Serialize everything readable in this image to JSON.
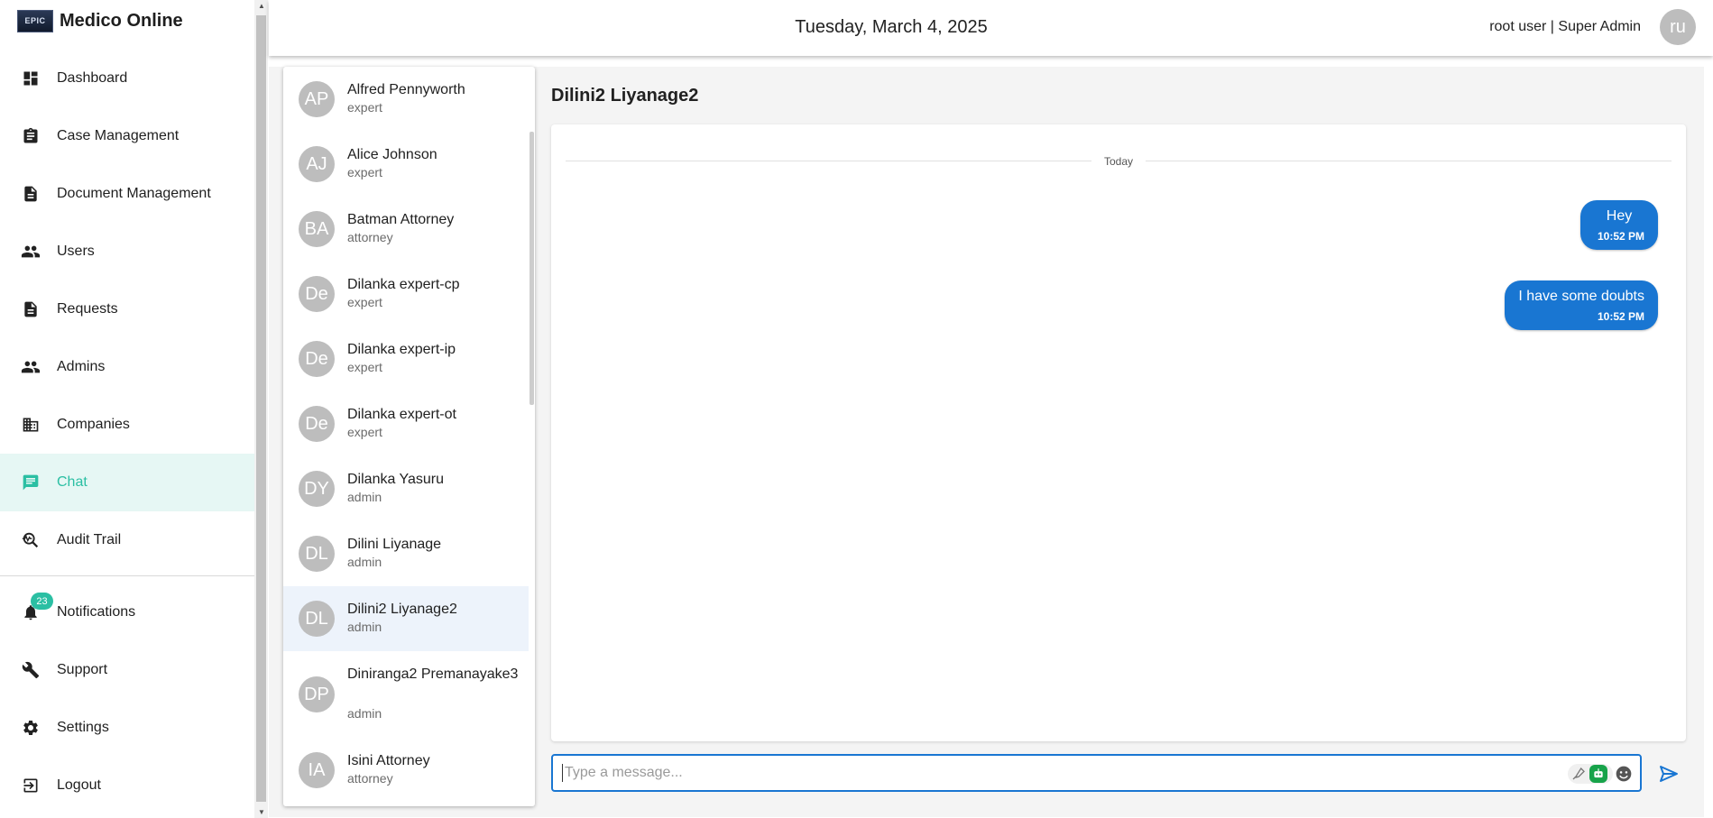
{
  "app": {
    "logo_text": "EPIC",
    "name": "Medico Online"
  },
  "sidebar": {
    "items": [
      {
        "label": "Dashboard",
        "icon": "dashboard-icon"
      },
      {
        "label": "Case Management",
        "icon": "clipboard-icon"
      },
      {
        "label": "Document Management",
        "icon": "document-icon"
      },
      {
        "label": "Users",
        "icon": "people-icon"
      },
      {
        "label": "Requests",
        "icon": "document-icon"
      },
      {
        "label": "Admins",
        "icon": "people-icon"
      },
      {
        "label": "Companies",
        "icon": "building-icon"
      },
      {
        "label": "Chat",
        "icon": "chat-icon",
        "active": true
      },
      {
        "label": "Audit Trail",
        "icon": "search-audit-icon"
      }
    ],
    "bottom_items": [
      {
        "label": "Notifications",
        "icon": "bell-icon",
        "badge": "23"
      },
      {
        "label": "Support",
        "icon": "wrench-icon"
      },
      {
        "label": "Settings",
        "icon": "gear-icon"
      },
      {
        "label": "Logout",
        "icon": "logout-icon"
      }
    ]
  },
  "header": {
    "date": "Tuesday, March 4, 2025",
    "user": "root user | Super Admin",
    "avatar_initials": "ru"
  },
  "contacts": [
    {
      "initials": "AP",
      "name": "Alfred Pennyworth",
      "role": "expert"
    },
    {
      "initials": "AJ",
      "name": "Alice Johnson",
      "role": "expert"
    },
    {
      "initials": "BA",
      "name": "Batman Attorney",
      "role": "attorney"
    },
    {
      "initials": "De",
      "name": "Dilanka expert-cp",
      "role": "expert"
    },
    {
      "initials": "De",
      "name": "Dilanka expert-ip",
      "role": "expert"
    },
    {
      "initials": "De",
      "name": "Dilanka expert-ot",
      "role": "expert"
    },
    {
      "initials": "DY",
      "name": "Dilanka Yasuru",
      "role": "admin"
    },
    {
      "initials": "DL",
      "name": "Dilini Liyanage",
      "role": "admin"
    },
    {
      "initials": "DL",
      "name": "Dilini2 Liyanage2",
      "role": "admin",
      "selected": true
    },
    {
      "initials": "DP",
      "name": "Diniranga2 Premanayake3",
      "role": "admin"
    },
    {
      "initials": "IA",
      "name": "Isini Attorney",
      "role": "attorney"
    }
  ],
  "chat": {
    "title": "Dilini2 Liyanage2",
    "day_label": "Today",
    "messages": [
      {
        "text": "Hey",
        "time": "10:52 PM"
      },
      {
        "text": "I have some doubts",
        "time": "10:52 PM"
      }
    ],
    "input_placeholder": "Type a message...",
    "bubble_color": "#1976d2"
  },
  "colors": {
    "accent": "#2bbfa3",
    "primary": "#1976d2"
  }
}
